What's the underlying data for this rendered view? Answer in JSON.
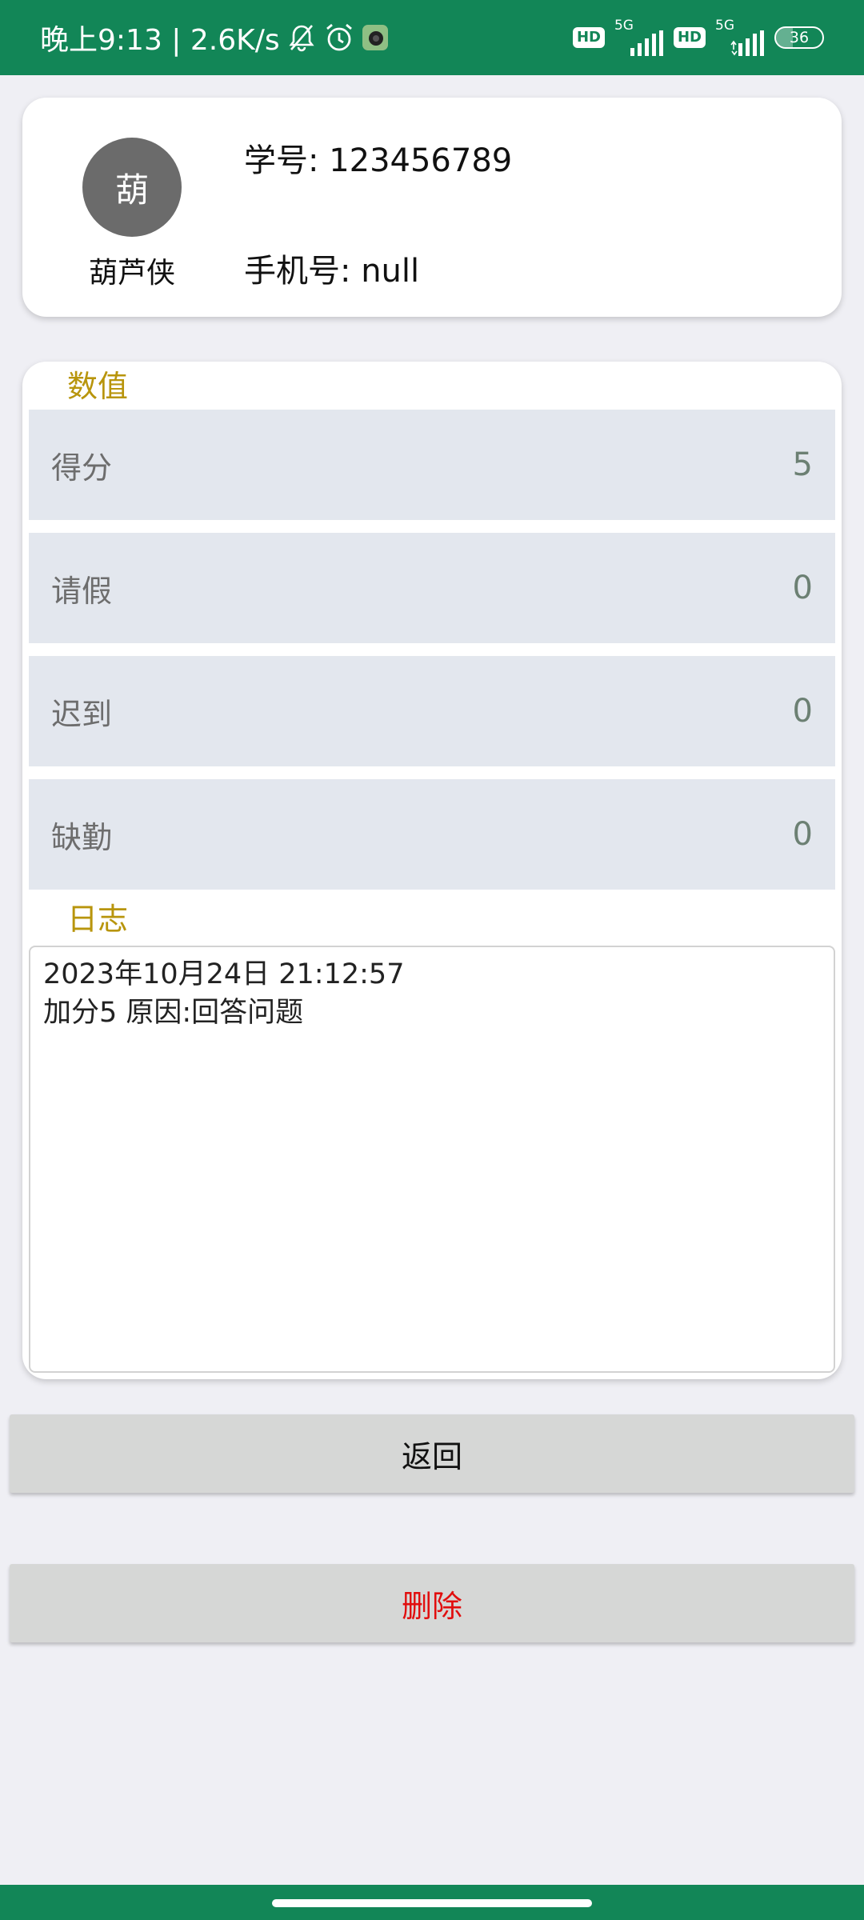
{
  "status_bar": {
    "time_speed": "晚上9:13 | 2.6K/s",
    "hd1": "HD",
    "net1": "5G",
    "hd2": "HD",
    "net2": "5G",
    "battery": "36",
    "battery_level": 0.36
  },
  "profile": {
    "avatar_char": "葫",
    "name": "葫芦侠",
    "student_id": "学号: 123456789",
    "phone": "手机号: null"
  },
  "values_section": {
    "title": "数值",
    "rows": [
      {
        "label": "得分",
        "value": "5"
      },
      {
        "label": "请假",
        "value": "0"
      },
      {
        "label": "迟到",
        "value": "0"
      },
      {
        "label": "缺勤",
        "value": "0"
      }
    ]
  },
  "log_section": {
    "title": "日志",
    "lines": [
      "2023年10月24日 21:12:57",
      "加分5 原因:回答问题"
    ]
  },
  "buttons": {
    "back": "返回",
    "delete": "删除"
  },
  "colors": {
    "status_bar": "#128657",
    "section_title": "#b8950c",
    "delete_text": "#e10e0e"
  }
}
